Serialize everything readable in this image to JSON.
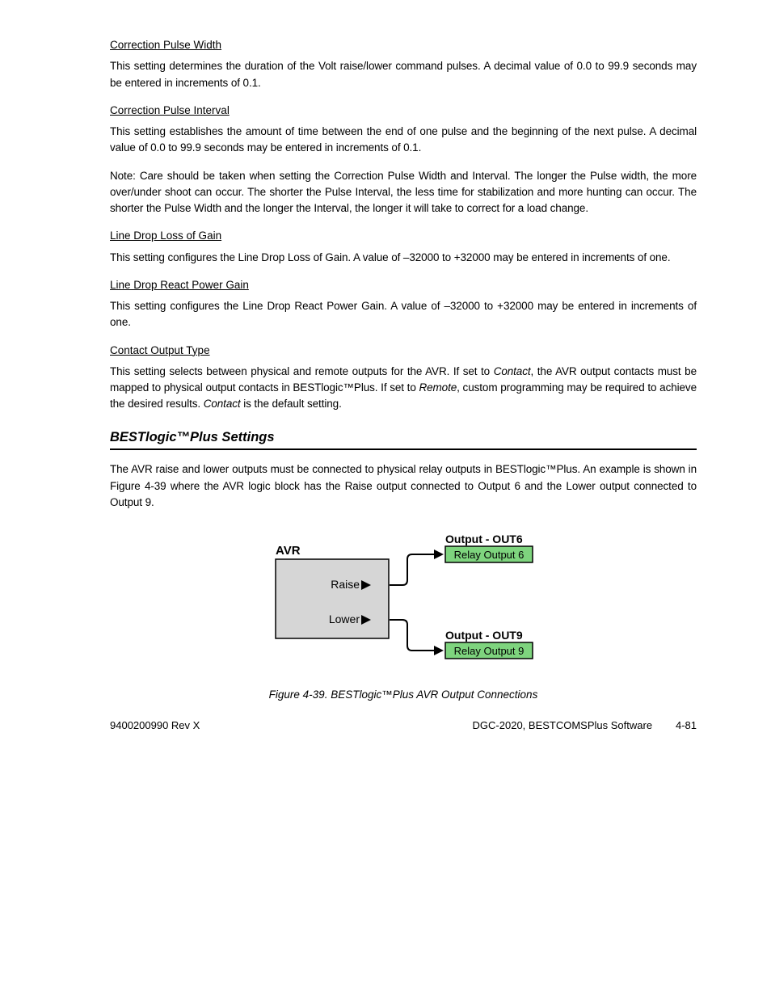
{
  "sections": {
    "pulseWidth": {
      "heading": "Correction Pulse Width",
      "body": "This setting determines the duration of the Volt raise/lower command pulses. A decimal value of 0.0 to 99.9 seconds may be entered in increments of 0.1."
    },
    "pulseInterval": {
      "heading": "Correction Pulse Interval",
      "body": "This setting establishes the amount of time between the end of one pulse and the beginning of the next pulse. A decimal value of 0.0 to 99.9 seconds may be entered in increments of 0.1."
    },
    "pulseNote": {
      "body": "Note: Care should be taken when setting the Correction Pulse Width and Interval. The longer the Pulse width, the more over/under shoot can occur. The shorter the Pulse Interval, the less time for stabilization and more hunting can occur. The shorter the Pulse Width and the longer the Interval, the longer it will take to correct for a load change."
    },
    "lossGain": {
      "heading": "Line Drop Loss of Gain",
      "body": "This setting configures the Line Drop Loss of Gain. A value of ",
      "body_part2": "32000 to +32000 may be entered in increments of one."
    },
    "reactPower": {
      "heading": "Line Drop React Power Gain",
      "body": "This setting configures the Line Drop React Power Gain. A value of ",
      "body_part2": "32000 to +32000 may be entered in increments of one."
    },
    "contactOutput": {
      "heading": "Contact Output Type",
      "body_a": "This setting selects between physical and remote outputs for the AVR. If set to ",
      "body_b": ", the AVR output contacts must be mapped to physical output contacts in BESTlogic",
      "body_c": "Plus. If set to ",
      "body_d": ", custom programming may be required to achieve the desired results. ",
      "body_e": " is the default setting."
    },
    "contactItalics": {
      "contact": "Contact",
      "remote": "Remote"
    }
  },
  "logicSection": {
    "title": "BESTlogic™Plus Settings",
    "body_a": "The AVR raise and lower outputs must be connected to physical relay outputs in BESTlogic",
    "body_b": "Plus. An example is shown in Figure 4-39 where the AVR logic block has the Raise output connected to Output 6 and the Lower output connected to Output 9."
  },
  "diagram": {
    "avr_label": "AVR",
    "raise": "Raise",
    "lower": "Lower",
    "out6_title": "Output - OUT6",
    "out6_relay": "Relay Output 6",
    "out9_title": "Output - OUT9",
    "out9_relay": "Relay Output 9"
  },
  "caption": "Figure 4-39. BESTlogic™Plus AVR Output Connections",
  "footer": {
    "left": "9400200990 Rev X",
    "right": "DGC-2020, BESTCOMSPlus Software",
    "page": "4-81"
  }
}
